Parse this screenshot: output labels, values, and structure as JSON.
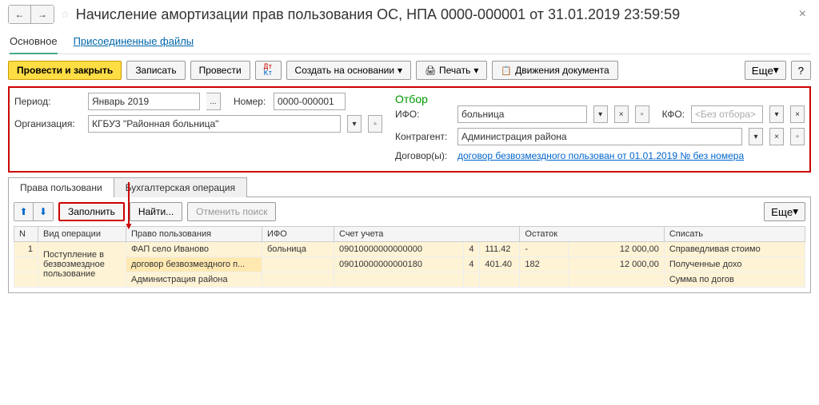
{
  "title": "Начисление амортизации прав пользования ОС, НПА 0000-000001 от 31.01.2019 23:59:59",
  "nav": {
    "back": "←",
    "forward": "→"
  },
  "topnav": {
    "main": "Основное",
    "files": "Присоединенные файлы"
  },
  "toolbar": {
    "post_close": "Провести и закрыть",
    "save": "Записать",
    "post": "Провести",
    "create_based": "Создать на основании",
    "print": "Печать",
    "movements": "Движения документа",
    "more": "Еще",
    "help": "?"
  },
  "form": {
    "period_lbl": "Период:",
    "period_val": "Январь 2019",
    "number_lbl": "Номер:",
    "number_val": "0000-000001",
    "org_lbl": "Организация:",
    "org_val": "КГБУЗ \"Районная больница\"",
    "filter_title": "Отбор",
    "ifo_lbl": "ИФО:",
    "ifo_val": "больница",
    "kfo_lbl": "КФО:",
    "kfo_placeholder": "<Без отбора>",
    "contractor_lbl": "Контрагент:",
    "contractor_val": "Администрация  района",
    "contracts_lbl": "Договор(ы):",
    "contracts_link": "договор безвозмездного пользован от 01.01.2019 № без номера"
  },
  "tabs": {
    "t1": "Права пользовани",
    "t2": "Бухгалтерская операция"
  },
  "tab_toolbar": {
    "fill": "Заполнить",
    "find": "Найти...",
    "cancel_find": "Отменить поиск",
    "more": "Еще"
  },
  "table": {
    "headers": {
      "n": "N",
      "op_type": "Вид операции",
      "right": "Право пользования",
      "ifo": "ИФО",
      "account": "Счет учета",
      "balance": "Остаток",
      "writeoff": "Списать"
    },
    "rows": [
      {
        "n": "1",
        "op": "Поступление в безвозмездное пользование",
        "right": "ФАП село Иваново",
        "ifo": "больница",
        "acc": "09010000000000000",
        "a2": "4",
        "a3": "111.42",
        "bal": "-",
        "sum": "12 000,00",
        "wo": "Справедливая стоимо"
      },
      {
        "right": "договор безвозмездного п...",
        "acc": "09010000000000180",
        "a2": "4",
        "a3": "401.40",
        "bal": "182",
        "sum": "12 000,00",
        "wo": "Полученные дохо"
      },
      {
        "right": "Администрация  района",
        "wo": "Сумма по догов"
      }
    ]
  }
}
